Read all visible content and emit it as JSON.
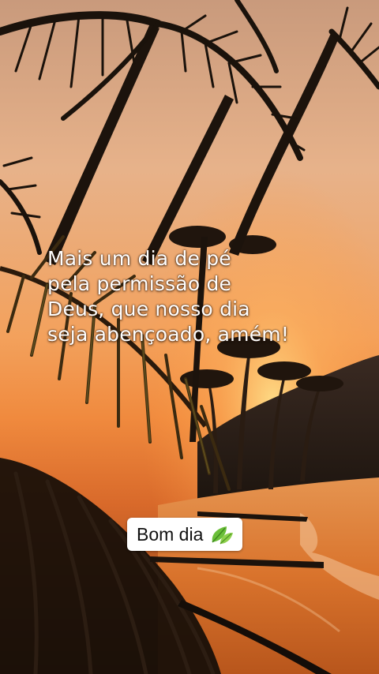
{
  "quote": {
    "lines": [
      "Mais um dia de pé",
      "pela permissão de",
      "Deus, que nosso dia",
      "seja abençoado, amém!"
    ]
  },
  "sticker": {
    "label": "Bom dia",
    "icon": "leaves-icon"
  },
  "colors": {
    "sky_top": "#d9a27a",
    "sky_mid": "#f2a35e",
    "sun": "#ffd37a",
    "sea": "#e8893a",
    "silhouette": "#1c130c"
  }
}
